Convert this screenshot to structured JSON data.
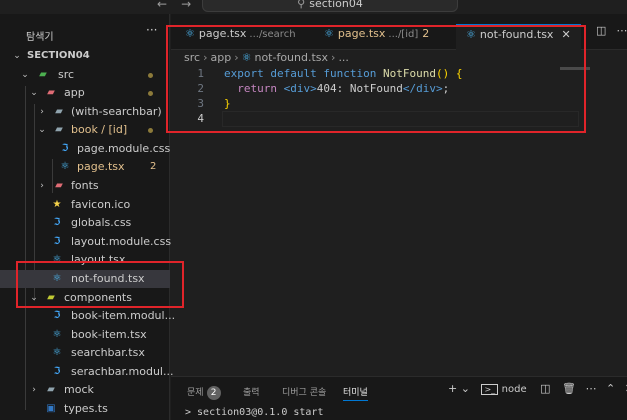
{
  "title_bar": {
    "back": "←",
    "forward": "→",
    "search_text": "section04"
  },
  "sidebar": {
    "header": "탐색기",
    "more": "···",
    "root": "SECTION04",
    "items": [
      {
        "label": "src"
      },
      {
        "label": "app"
      },
      {
        "label": "(with-searchbar)"
      },
      {
        "label": "book / [id]"
      },
      {
        "label": "page.module.css"
      },
      {
        "label": "page.tsx",
        "badge": "2"
      },
      {
        "label": "fonts"
      },
      {
        "label": "favicon.ico"
      },
      {
        "label": "globals.css"
      },
      {
        "label": "layout.module.css"
      },
      {
        "label": "layout.tsx"
      },
      {
        "label": "not-found.tsx"
      },
      {
        "label": "components"
      },
      {
        "label": "book-item.modul..."
      },
      {
        "label": "book-item.tsx"
      },
      {
        "label": "searchbar.tsx"
      },
      {
        "label": "serachbar.modul..."
      },
      {
        "label": "mock"
      },
      {
        "label": "types.ts"
      }
    ]
  },
  "tabs": [
    {
      "label": "page.tsx",
      "desc": ".../search"
    },
    {
      "label": "page.tsx",
      "desc": ".../[id]",
      "badge": "2"
    },
    {
      "label": "not-found.tsx",
      "close": "✕"
    }
  ],
  "breadcrumb": [
    "src",
    "app",
    "not-found.tsx",
    "..."
  ],
  "code": {
    "line_numbers": [
      "1",
      "2",
      "3",
      "4"
    ],
    "l1": {
      "kw1": "export",
      "kw2": "default",
      "kw3": "function",
      "name": "NotFound",
      "rest": "() {"
    },
    "l2": {
      "kw": "return",
      "open": "<div>",
      "text": "404: NotFound",
      "close": "</div>",
      "end": ";"
    },
    "l3": {
      "brace": "}"
    }
  },
  "panel": {
    "tabs": [
      {
        "label": "문제",
        "badge": "2"
      },
      {
        "label": "출력"
      },
      {
        "label": "디버그 콘솔"
      },
      {
        "label": "터미널"
      }
    ],
    "terminal_name": "node",
    "terminal_output": "> section03@0.1.0 start"
  },
  "colors": {
    "highlight": "#e0242a",
    "accent": "#0078d4",
    "warning": "#e2c08d"
  }
}
